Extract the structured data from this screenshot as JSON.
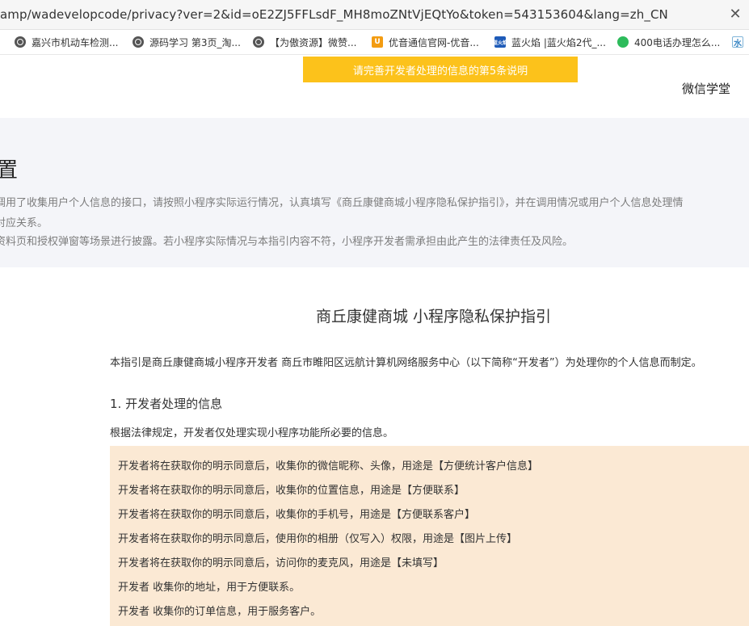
{
  "browser": {
    "url": "amp/wadevelopcode/privacy?ver=2&id=oE2ZJ5FFLsdF_MH8moZNtVjEQtYo&token=543153604&lang=zh_CN",
    "close_label": "✕",
    "bookmarks": [
      {
        "label": "嘉兴市机动车检测...",
        "icon": "globe-icon"
      },
      {
        "label": "源码学习 第3页_淘...",
        "icon": "globe-icon"
      },
      {
        "label": "【为傲资源】微赞...",
        "icon": "globe-icon"
      },
      {
        "label": "优音通信官网-优音...",
        "icon": "u-icon",
        "glyph": "U"
      },
      {
        "label": "蓝火焰 |蓝火焰2代_...",
        "icon": "lanhuoyan-icon",
        "glyph": "蓝火焰"
      },
      {
        "label": "400电话办理怎么...",
        "icon": "wechat-green-icon"
      },
      {
        "label": "",
        "icon": "water-icon",
        "glyph": "水"
      }
    ]
  },
  "banner": {
    "text": "请完善开发者处理的信息的第5条说明"
  },
  "header": {
    "link": "微信学堂"
  },
  "settings": {
    "heading": "置",
    "lines": [
      "调用了收集用户个人信息的接口，请按照小程序实际运行情况，认真填写《商丘康健商城小程序隐私保护指引》，并在调用情况或用户个人信息处理情",
      "对应关系。",
      "资料页和授权弹窗等场景进行披露。若小程序实际情况与本指引内容不符，小程序开发者需承担由此产生的法律责任及风险。"
    ]
  },
  "document": {
    "title": "商丘康健商城 小程序隐私保护指引",
    "intro": "本指引是商丘康健商城小程序开发者 商丘市睢阳区远航计算机网络服务中心（以下简称“开发者”）为处理你的个人信息而制定。",
    "section1": {
      "title": "1.  开发者处理的信息",
      "desc": "根据法律规定，开发者仅处理实现小程序功能所必要的信息。",
      "items": [
        "开发者将在获取你的明示同意后，收集你的微信昵称、头像，用途是【方便统计客户信息】",
        "开发者将在获取你的明示同意后，收集你的位置信息，用途是【方便联系】",
        "开发者将在获取你的明示同意后，收集你的手机号，用途是【方便联系客户】",
        "开发者将在获取你的明示同意后，使用你的相册（仅写入）权限，用途是【图片上传】",
        "开发者将在获取你的明示同意后，访问你的麦克风，用途是【未填写】",
        "开发者  收集你的地址，用于方便联系。",
        "开发者  收集你的订单信息，用于服务客户。"
      ]
    }
  }
}
